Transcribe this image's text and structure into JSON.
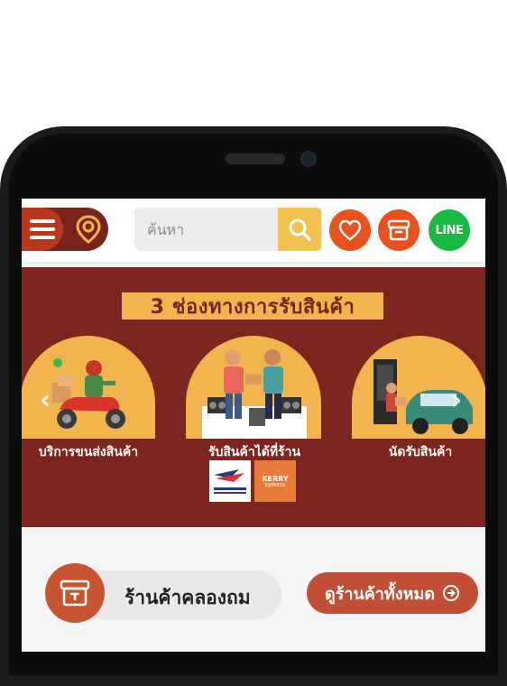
{
  "header": {
    "search_placeholder": "ค้นหา",
    "line_label": "LINE"
  },
  "banner": {
    "title": "3 ช่องทางการรับสินค้า",
    "channels": [
      {
        "label": "บริการขนส่งสินค้า"
      },
      {
        "label": "รับสินค้าได้ที่ร้าน"
      },
      {
        "label": "นัดรับสินค้า"
      }
    ],
    "arrow_left": "‹",
    "arrow_right": "›",
    "logo_kerry": "KERRY",
    "logo_kerry_sub": "EXPRESS",
    "colors": {
      "banner_bg": "#7d2620",
      "accent": "#f2b54e"
    }
  },
  "store_section": {
    "label": "ร้านค้าคลองถม",
    "all_stores_button": "ดูร้านค้าทั้งหมด"
  },
  "icons": [
    "menu-icon",
    "location-pin-icon",
    "search-icon",
    "heart-icon",
    "store-icon",
    "line-icon",
    "arrow-circle-right-icon",
    "thai-post-logo",
    "kerry-logo"
  ]
}
